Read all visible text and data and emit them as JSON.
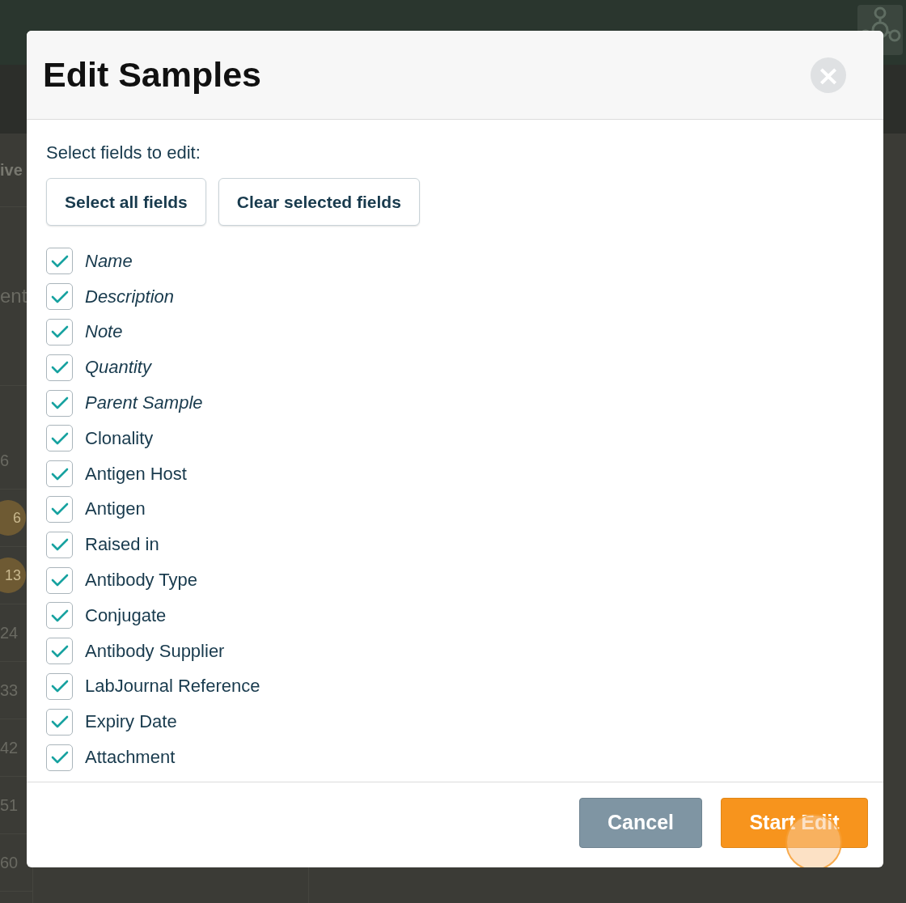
{
  "background": {
    "column_label": "ive",
    "section_label": "ent",
    "row_numbers": [
      {
        "text": "6",
        "badge": false
      },
      {
        "text": "6",
        "badge": true
      },
      {
        "text": "13",
        "badge": true
      },
      {
        "text": "24",
        "badge": false
      },
      {
        "text": "33",
        "badge": false
      },
      {
        "text": "42",
        "badge": false
      },
      {
        "text": "51",
        "badge": false
      },
      {
        "text": "60",
        "badge": false
      }
    ]
  },
  "dialog": {
    "title": "Edit Samples",
    "close": "×",
    "prompt": "Select fields to edit:",
    "actions": [
      "Select all fields",
      "Clear selected fields"
    ],
    "fields": [
      {
        "label": "Name",
        "italic": true,
        "checked": true
      },
      {
        "label": "Description",
        "italic": true,
        "checked": true
      },
      {
        "label": "Note",
        "italic": true,
        "checked": true
      },
      {
        "label": "Quantity",
        "italic": true,
        "checked": true
      },
      {
        "label": "Parent Sample",
        "italic": true,
        "checked": true
      },
      {
        "label": "Clonality",
        "italic": false,
        "checked": true
      },
      {
        "label": "Antigen Host",
        "italic": false,
        "checked": true
      },
      {
        "label": "Antigen",
        "italic": false,
        "checked": true
      },
      {
        "label": "Raised in",
        "italic": false,
        "checked": true
      },
      {
        "label": "Antibody Type",
        "italic": false,
        "checked": true
      },
      {
        "label": "Conjugate",
        "italic": false,
        "checked": true
      },
      {
        "label": "Antibody Supplier",
        "italic": false,
        "checked": true
      },
      {
        "label": "LabJournal Reference",
        "italic": false,
        "checked": true
      },
      {
        "label": "Expiry Date",
        "italic": false,
        "checked": true
      },
      {
        "label": "Attachment",
        "italic": false,
        "checked": true
      }
    ],
    "cancel": "Cancel",
    "submit": "Start Edit"
  }
}
